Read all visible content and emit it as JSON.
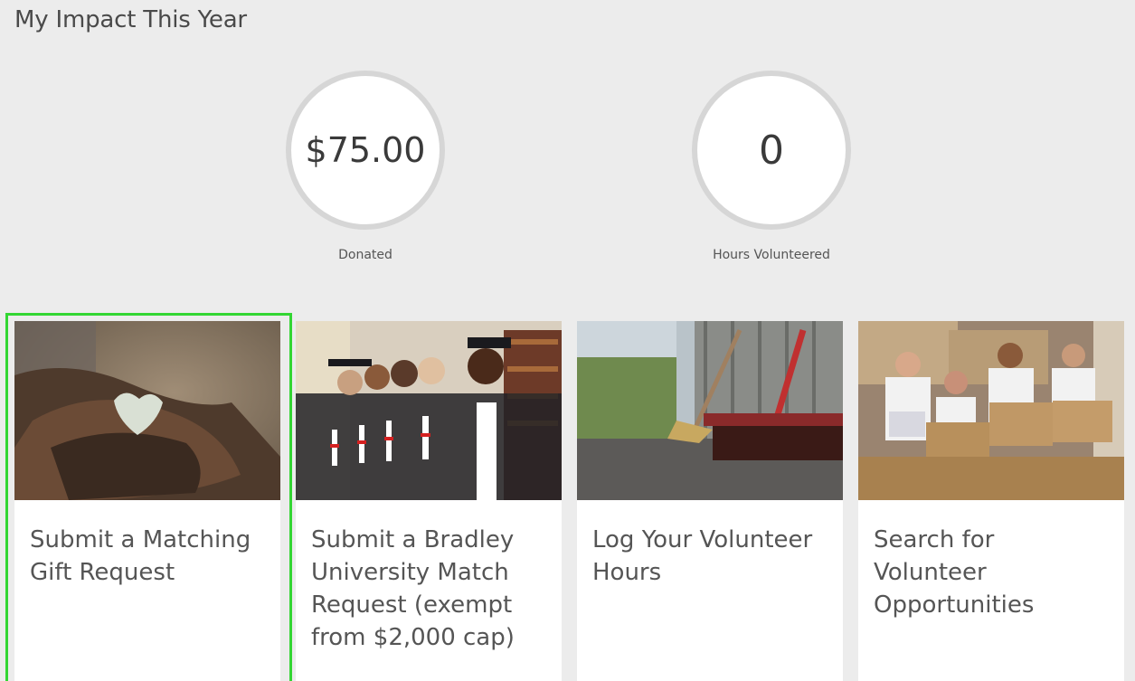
{
  "impact": {
    "title": "My Impact This Year",
    "donated": {
      "value": "$75.00",
      "label": "Donated"
    },
    "hours": {
      "value": "0",
      "label": "Hours Volunteered"
    }
  },
  "cards": [
    {
      "title": "Submit a Matching Gift Request",
      "image": "hands-holding-paper-heart"
    },
    {
      "title": "Submit a Bradley University Match Request (exempt from $2,000 cap)",
      "image": "graduates-with-diplomas"
    },
    {
      "title": "Log Your Volunteer Hours",
      "image": "broom-sweeping-pavement"
    },
    {
      "title": "Search for Volunteer Opportunities",
      "image": "volunteers-with-donation-boxes"
    }
  ],
  "colors": {
    "background": "#ececec",
    "card": "#ffffff",
    "circle_border": "#d6d6d6",
    "focus_ring": "#33d633",
    "text": "#555555"
  }
}
